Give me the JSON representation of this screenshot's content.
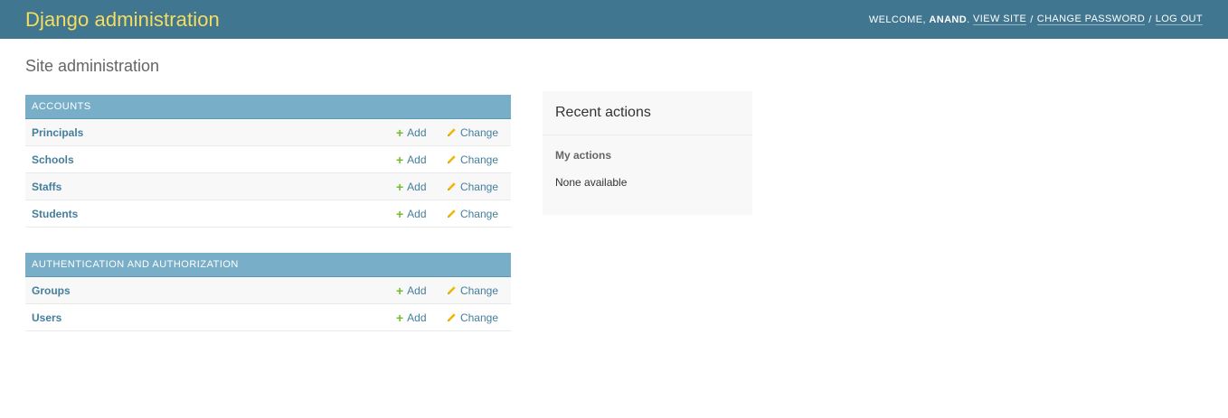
{
  "header": {
    "brand": "Django administration",
    "welcome": "WELCOME,",
    "username": "ANAND",
    "view_site": "VIEW SITE",
    "change_password": "CHANGE PASSWORD",
    "log_out": "LOG OUT",
    "separator": "/",
    "period": "."
  },
  "page": {
    "title": "Site administration"
  },
  "apps": [
    {
      "caption": "Accounts",
      "models": [
        {
          "name": "Principals",
          "add": "Add",
          "change": "Change"
        },
        {
          "name": "Schools",
          "add": "Add",
          "change": "Change"
        },
        {
          "name": "Staffs",
          "add": "Add",
          "change": "Change"
        },
        {
          "name": "Students",
          "add": "Add",
          "change": "Change"
        }
      ]
    },
    {
      "caption": "Authentication and Authorization",
      "models": [
        {
          "name": "Groups",
          "add": "Add",
          "change": "Change"
        },
        {
          "name": "Users",
          "add": "Add",
          "change": "Change"
        }
      ]
    }
  ],
  "recent": {
    "title": "Recent actions",
    "subtitle": "My actions",
    "empty": "None available"
  },
  "colors": {
    "header_bg": "#417690",
    "brand": "#f5dd5d",
    "caption_bg": "#79aec8",
    "link": "#447e9b",
    "add_icon": "#70bf2b",
    "change_icon": "#efb80b"
  },
  "icons": {
    "add": "plus-icon",
    "change": "pencil-icon"
  }
}
